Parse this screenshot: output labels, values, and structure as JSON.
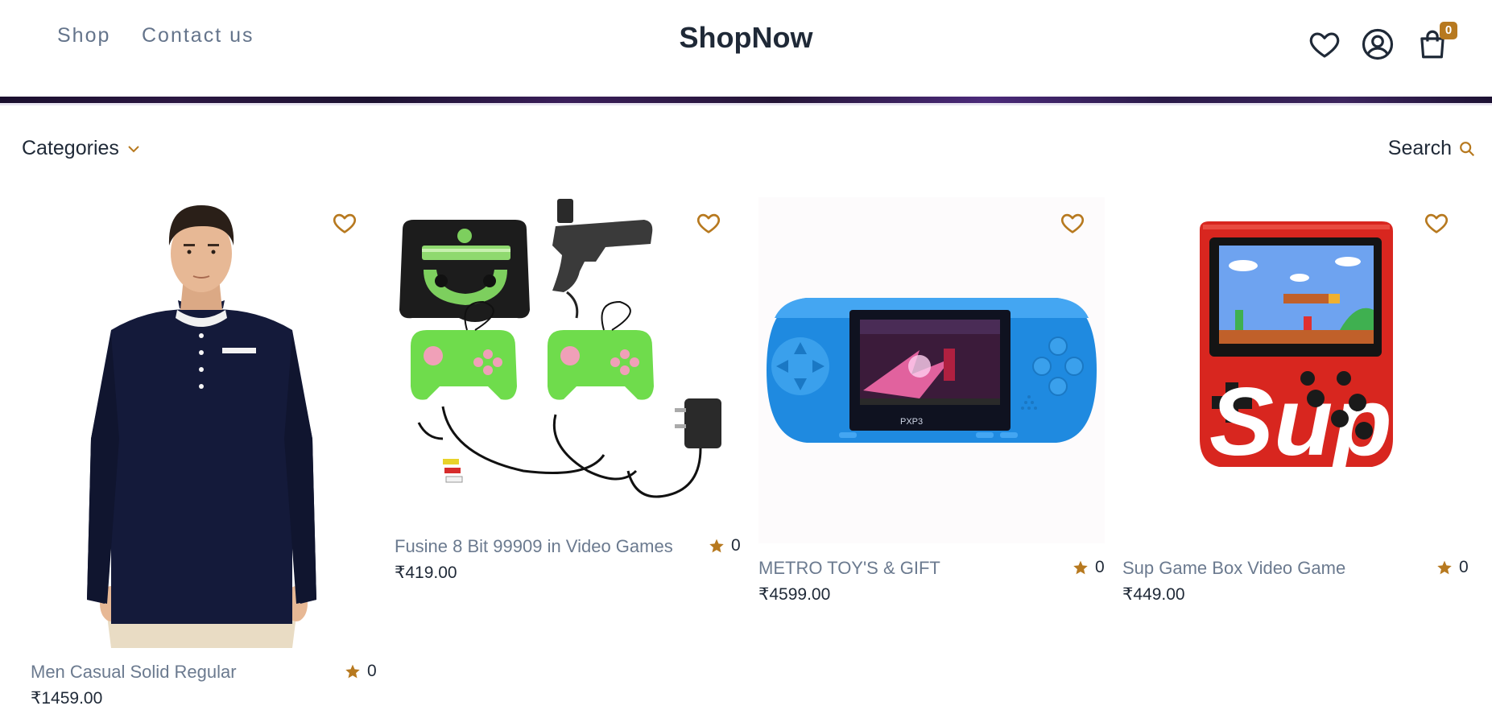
{
  "header": {
    "nav": [
      {
        "label": "Shop"
      },
      {
        "label": "Contact us"
      }
    ],
    "brand": "ShopNow",
    "cart_count": "0",
    "icons": [
      "heart-icon",
      "account-icon",
      "shopping-bag-icon"
    ]
  },
  "toolbar": {
    "categories_label": "Categories",
    "search_label": "Search"
  },
  "products": [
    {
      "name": "Men Casual Solid Regular",
      "price": "₹1459.00",
      "rating": "0",
      "image": "navy henley t-shirt on model"
    },
    {
      "name": "Fusine 8 Bit 99909 in Video Games",
      "price": "₹419.00",
      "rating": "0",
      "image": "8-bit console set with gun, two green controllers, cables and adapter"
    },
    {
      "name": "METRO TOY'S & GIFT",
      "price": "₹4599.00",
      "rating": "0",
      "image": "blue handheld PXP3 console"
    },
    {
      "name": "Sup Game Box Video Game",
      "price": "₹449.00",
      "rating": "0",
      "image": "red Sup handheld game box"
    }
  ],
  "colors": {
    "accent": "#b7791f",
    "text": "#1f2937",
    "muted": "#6b7a8f"
  }
}
